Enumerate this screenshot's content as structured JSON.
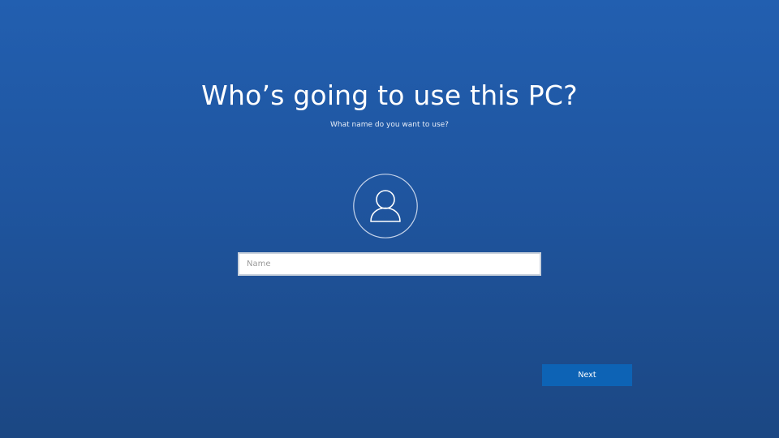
{
  "page": {
    "title": "Who’s going to use this PC?",
    "subtitle": "What name do you want to use?"
  },
  "avatar": {
    "icon": "user-icon"
  },
  "name_input": {
    "placeholder": "Name",
    "value": ""
  },
  "actions": {
    "next_label": "Next"
  },
  "colors": {
    "background_top": "#225fb0",
    "background_bottom": "#1b4783",
    "button": "#0d63b5",
    "text": "#ffffff"
  }
}
